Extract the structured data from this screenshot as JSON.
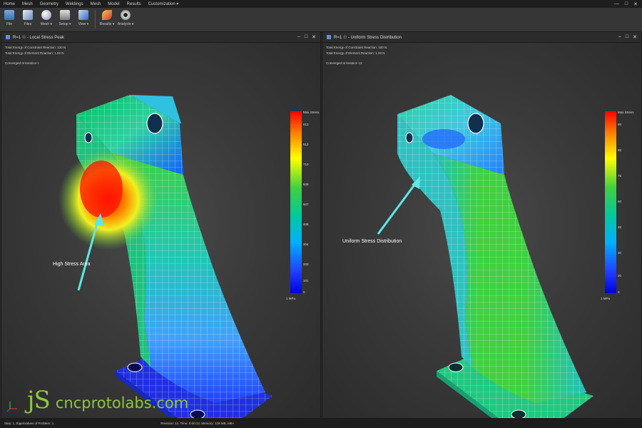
{
  "menu": {
    "items": [
      "Home",
      "Mesh",
      "Geometry",
      "Weldings",
      "Mesh",
      "Model",
      "Results",
      "Customization ▾"
    ],
    "window_controls": [
      "—",
      "□",
      "✕"
    ]
  },
  "ribbon": {
    "buttons": [
      {
        "label": "File",
        "icon": "grid-icon",
        "color": "#7aa7e0"
      },
      {
        "label": "Files",
        "icon": "cube-icon",
        "color": "#b8c8e8"
      },
      {
        "label": "Mesh ▾",
        "icon": "sphere-icon",
        "color": "#c8c8d8"
      },
      {
        "label": "Setup ▾",
        "icon": "setup-icon",
        "color": "#c0c0c0"
      },
      {
        "label": "View ▾",
        "icon": "view-icon",
        "color": "#9ab8e8"
      },
      {
        "label": "Results ▾",
        "icon": "results-icon",
        "color": "#e08a30"
      },
      {
        "label": "Analysis ▾",
        "icon": "gear-icon",
        "color": "#d0d0d0"
      }
    ]
  },
  "left_panel": {
    "title": "R=1 ☉ - Local Stress Peak",
    "info": [
      "Total Energy of Constraint Reaction: 120 N",
      "Total Energy of Element Reaction: 1.00 N",
      "Converged at iteration 1"
    ],
    "legend": {
      "title": "Max Stress",
      "ticks": [
        "913",
        "812",
        "710",
        "609",
        "507",
        "406",
        "304",
        "203",
        "101",
        "0"
      ],
      "unit": "1 MPa"
    },
    "callout": "High Stress Area"
  },
  "right_panel": {
    "title": "R=1 ☉ - Uniform Stress Distribution",
    "info": [
      "Total Energy of Constraint Reaction: 100 N",
      "Total Energy of Element Reaction: 1.00 N",
      "Converged at iteration 13"
    ],
    "legend": {
      "title": "Max Stress",
      "ticks": [
        "95",
        "85",
        "75",
        "60",
        "45",
        "30",
        "20",
        "0"
      ],
      "unit": "1 MPa"
    },
    "callout": "Uniform Stress Distribution"
  },
  "watermark": {
    "js": "jS",
    "site": "cncprotolabs.com"
  },
  "status": {
    "left": "Step: 1, Eigenvalues of Problem: 1",
    "center": "Revision: 12, Time: 0:00:12, Memory: 128 MB,  MB+"
  },
  "colors": {
    "accent": "#8dc63f",
    "arrow": "#5ce8e8"
  }
}
